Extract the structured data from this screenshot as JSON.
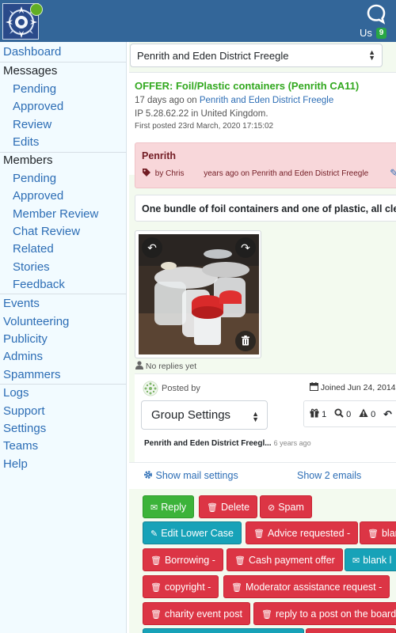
{
  "header": {
    "user_label": "Us",
    "user_count": "9"
  },
  "sidebar": {
    "dashboard": "Dashboard",
    "messages_head": "Messages",
    "messages": [
      "Pending",
      "Approved",
      "Review",
      "Edits"
    ],
    "members_head": "Members",
    "members": [
      "Pending",
      "Approved",
      "Member Review",
      "Chat Review",
      "Related",
      "Stories",
      "Feedback"
    ],
    "group2": [
      "Events",
      "Volunteering",
      "Publicity",
      "Admins",
      "Spammers"
    ],
    "group3": [
      "Logs",
      "Support",
      "Settings",
      "Teams",
      "Help"
    ]
  },
  "group_select": {
    "value": "Penrith and Eden District Freegle"
  },
  "post": {
    "subject": "OFFER: Foil/Plastic containers (Penrith CA11)",
    "age": "17 days ago on",
    "group_link": "Penrith and Eden District Freegle",
    "ip": "IP 5.28.62.22 in United Kingdom.",
    "first_posted": "First posted 23rd March, 2020 17:15:02"
  },
  "edit_note": {
    "title": "Penrith",
    "by": "by Chris",
    "ago": "years ago on Penrith and Eden District Freegle"
  },
  "message_text": "One bundle of foil containers and one of plastic, all cle",
  "no_replies": "No replies yet",
  "poster": {
    "posted_by": "Posted by",
    "joined": "Joined Jun 24, 2014",
    "settings_select": "Group Settings",
    "stats": [
      "1",
      "0",
      "0"
    ],
    "footer_group": "Penrith and Eden District Freegl...",
    "footer_ago": "6 years ago"
  },
  "links": {
    "mail_settings": "Show mail settings",
    "emails": "Show 2 emails"
  },
  "buttons": {
    "reply": "Reply",
    "delete": "Delete",
    "spam": "Spam",
    "edit_lower": "Edit Lower Case",
    "advice": "Advice requested -",
    "blank_partial": "blan",
    "borrowing": "Borrowing -",
    "cash": "Cash payment offer",
    "blank_l": "blank l",
    "copyright": "copyright -",
    "moderator": "Moderator assistance request -",
    "charity": "charity event post",
    "reply_post": "reply to a post on the board"
  },
  "colors": {
    "topbar": "#336699",
    "sidebar_bg": "#f2fbff",
    "link": "#2c6db5",
    "offer_green": "#32a81f",
    "danger": "#dc3545",
    "success": "#3cb33a",
    "info": "#17a2b8"
  },
  "icons": {
    "chat": "chat-bubble-icon",
    "tag": "tag-icon",
    "pencil": "pencil-icon",
    "user": "user-icon",
    "calendar": "calendar-icon",
    "gift": "gift-icon",
    "search": "search-icon",
    "warning": "warning-icon",
    "reply_arrow": "reply-icon",
    "gear": "gear-icon",
    "trash": "trash-icon",
    "ban": "ban-icon",
    "envelope": "envelope-icon"
  }
}
